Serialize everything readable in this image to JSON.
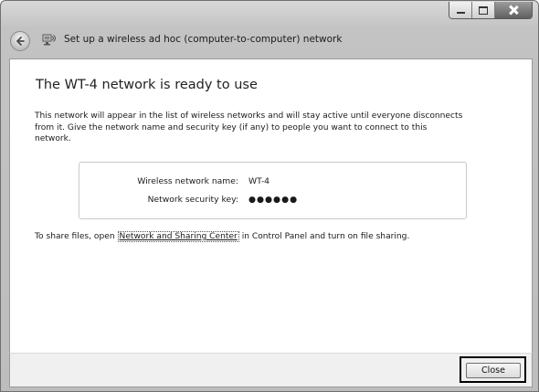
{
  "window": {
    "title": "Set up a wireless ad hoc (computer-to-computer) network",
    "controls": [
      "minimize-icon",
      "maximize-icon",
      "close-icon"
    ]
  },
  "content": {
    "heading": "The WT-4 network is ready to use",
    "description": "This network will appear in the list of wireless networks and will stay active until everyone disconnects from it. Give the network name and security key (if any) to people you want to connect to this network.",
    "network_name_label": "Wireless network name:",
    "network_name_value": "WT-4",
    "security_key_label": "Network security key:",
    "security_key_value": "●●●●●●",
    "share_prefix": "To share files, open ",
    "share_link": "Network and Sharing Center",
    "share_suffix": " in Control Panel and turn on file sharing."
  },
  "footer": {
    "close_label": "Close"
  },
  "colors": {
    "title_bar": "#c3c3c3",
    "content_bg": "#ffffff",
    "footer_bg": "#f0f0f0",
    "highlight": "#000000"
  }
}
